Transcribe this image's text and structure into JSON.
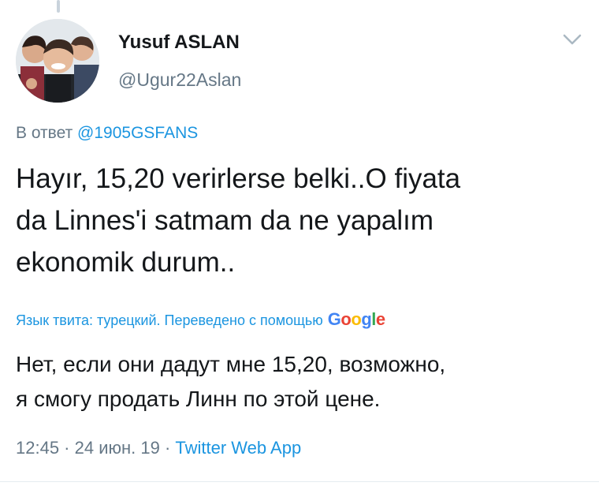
{
  "tweet": {
    "author": {
      "display_name": "Yusuf ASLAN",
      "handle": "@Ugur22Aslan",
      "avatar_icon": "avatar-photo-icon"
    },
    "reply": {
      "prefix": "В ответ",
      "mention": "@1905GSFANS"
    },
    "text_lines": [
      "Hayır, 15,20 verirlerse belki..O fiyata",
      "da Linnes'i satmam da ne yapalım",
      "ekonomik durum.."
    ],
    "translation_info": {
      "label": "Язык твита: турецкий. Переведено с помощью",
      "provider": [
        "G",
        "o",
        "o",
        "g",
        "l",
        "e"
      ]
    },
    "translation_lines": [
      "Нет, если они дадут мне 15,20, возможно,",
      "я смогу продать Линн по этой цене."
    ],
    "meta": {
      "time": "12:45",
      "separator": " · ",
      "date": "24 июн. 19",
      "source": "Twitter Web App"
    },
    "menu_icon": "chevron-down-icon"
  },
  "colors": {
    "text": "#14171a",
    "secondary": "#657786",
    "link": "#1b95e0",
    "divider": "#e6ecf0"
  }
}
